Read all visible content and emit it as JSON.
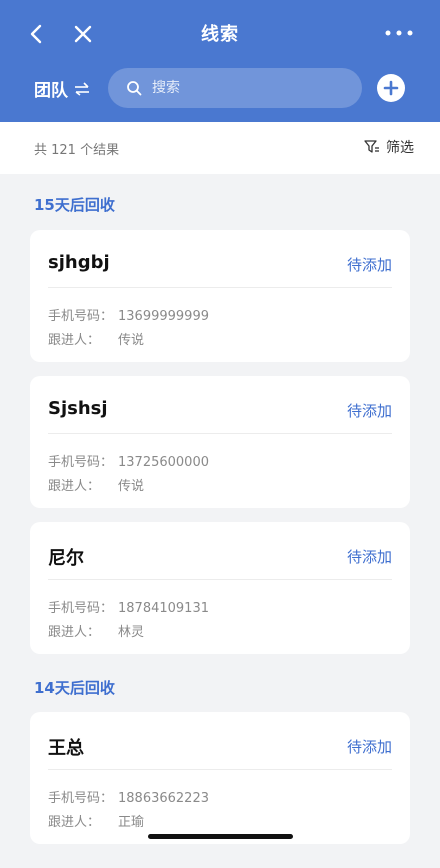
{
  "header": {
    "title": "线索",
    "team_label": "团队",
    "search_placeholder": "搜索",
    "icons": [
      "back-icon",
      "close-icon",
      "more-icon",
      "swap-icon",
      "search-icon",
      "plus-icon"
    ],
    "color": "#4a78d0"
  },
  "summary": {
    "result_text": "共 121 个结果",
    "filter_label": "筛选"
  },
  "groups": [
    {
      "title": "15天后回收"
    },
    {
      "title": "14天后回收"
    }
  ],
  "labels": {
    "phone": "手机号码：",
    "follower": "跟进人："
  },
  "cards": [
    {
      "name": "sjhgbj",
      "action": "待添加",
      "phone": "13699999999",
      "follower": "传说"
    },
    {
      "name": "Sjshsj",
      "action": "待添加",
      "phone": "13725600000",
      "follower": "传说"
    },
    {
      "name": "尼尔",
      "action": "待添加",
      "phone": "18784109131",
      "follower": "林灵"
    },
    {
      "name": "王总",
      "action": "待添加",
      "phone": "18863662223",
      "follower": "正瑜"
    }
  ],
  "accent_color": "#3f6fcf"
}
